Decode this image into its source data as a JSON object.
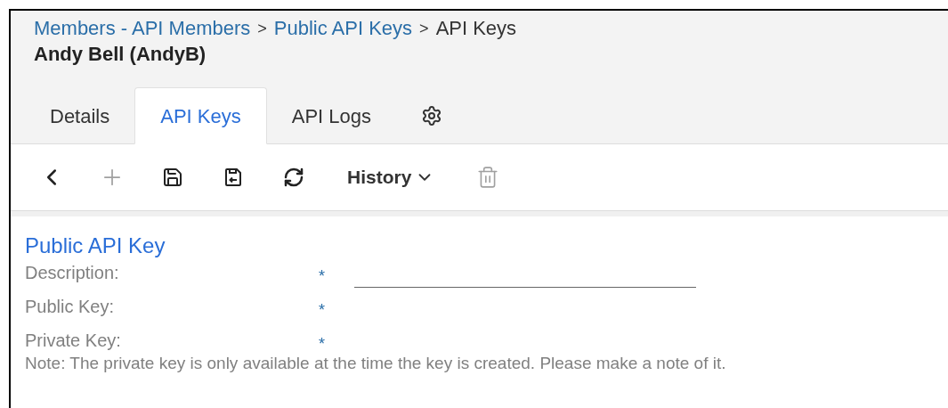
{
  "breadcrumb": [
    {
      "label": "Members - API Members",
      "link": true
    },
    {
      "separator": ">"
    },
    {
      "label": "Public API Keys",
      "link": true
    },
    {
      "separator": ">"
    },
    {
      "label": "API Keys",
      "link": false
    }
  ],
  "title": "Andy Bell (AndyB)",
  "tabs": [
    {
      "kind": "text",
      "label": "Details",
      "selected": false
    },
    {
      "kind": "text",
      "label": "API Keys",
      "selected": true
    },
    {
      "kind": "text",
      "label": "API Logs",
      "selected": false
    },
    {
      "kind": "settings",
      "selected": false
    }
  ],
  "toolbar": [
    {
      "kind": "back",
      "disabled": false
    },
    {
      "kind": "add",
      "disabled": true
    },
    {
      "kind": "save",
      "disabled": false
    },
    {
      "kind": "save-close",
      "disabled": false
    },
    {
      "kind": "refresh",
      "disabled": false
    },
    {
      "kind": "dropdown",
      "label": "History",
      "disabled": false
    },
    {
      "kind": "delete",
      "disabled": true
    }
  ],
  "section": {
    "title": "Public API Key",
    "fields": [
      {
        "kind": "input",
        "label": "Description:",
        "marker": "*"
      },
      {
        "kind": "readonly",
        "label": "Public Key:",
        "marker": "*"
      },
      {
        "kind": "readonly",
        "label": "Private Key:",
        "marker": "*"
      }
    ],
    "note": "Note: The private key is only available at the time the key is created. Please make a note of it."
  }
}
